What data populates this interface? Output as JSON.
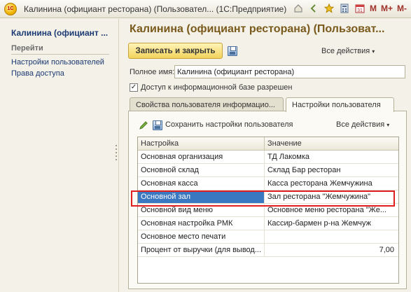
{
  "window": {
    "title": "Калинина (официант ресторана) (Пользовател... (1С:Предприятие)",
    "app_icon_label": "1С",
    "toolbar_icons": [
      "home-icon",
      "back-icon",
      "star-icon",
      "calculator-icon",
      "calendar-icon"
    ],
    "memory_buttons": [
      "M",
      "M+",
      "M-"
    ]
  },
  "left_panel": {
    "title": "Калинина (официант ...",
    "nav_heading": "Перейти",
    "nav_items": [
      "Настройки пользователей",
      "Права доступа"
    ]
  },
  "form": {
    "title": "Калинина (официант ресторана) (Пользоват...",
    "save_close_label": "Записать и закрыть",
    "all_actions_label": "Все действия",
    "fullname_label": "Полное имя:",
    "fullname_value": "Калинина (официант ресторана)",
    "access_checked": true,
    "access_label": "Доступ к информационной базе разрешен",
    "tabs": [
      {
        "label": "Свойства пользователя информацио...",
        "active": false
      },
      {
        "label": "Настройки пользователя",
        "active": true
      }
    ],
    "settings_toolbar": {
      "save_settings_label": "Сохранить настройки пользователя",
      "all_actions_label": "Все действия"
    },
    "table": {
      "headers": [
        "Настройка",
        "Значение"
      ],
      "rows": [
        {
          "setting": "Основная организация",
          "value": "ТД Лакомка"
        },
        {
          "setting": "Основной склад",
          "value": "Склад Бар ресторан"
        },
        {
          "setting": "Основная касса",
          "value": "Касса ресторана Жемчужина"
        },
        {
          "setting": "Основной зал",
          "value": "Зал ресторана \"Жемчужина\""
        },
        {
          "setting": "Основной вид меню",
          "value": "Основное меню ресторана \"Же..."
        },
        {
          "setting": "Основная настройка РМК",
          "value": "Кассир-бармен р-на Жемчуж"
        },
        {
          "setting": "Основное место печати",
          "value": ""
        },
        {
          "setting": "Процент от выручки (для вывод...",
          "value": "7,00"
        }
      ],
      "selected_row": 3
    }
  },
  "colors": {
    "accent_title": "#7a5a1c",
    "link": "#1c3a73",
    "selection": "#3b78c2",
    "highlight": "#e02020",
    "save_button": "#f2d35b"
  }
}
